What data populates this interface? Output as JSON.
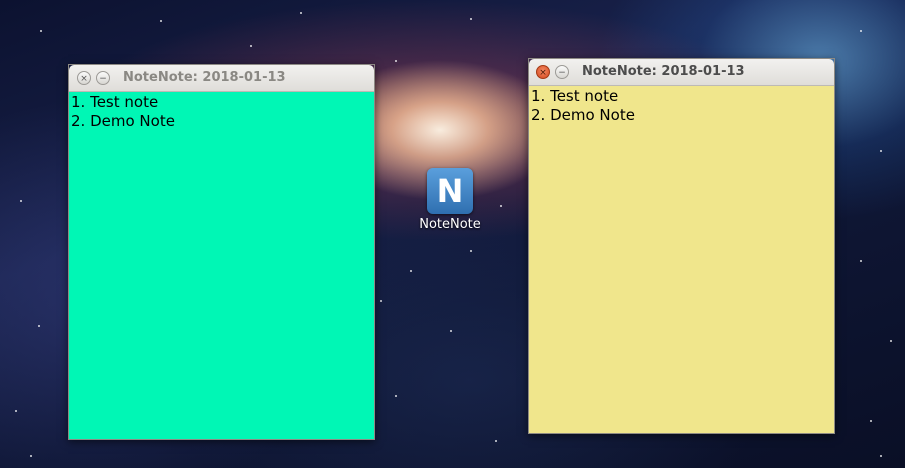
{
  "desktop": {
    "icon": {
      "label": "NoteNote",
      "glyph": "N",
      "icon_name": "notenote-app-icon",
      "tile_color": "#3b82c4"
    }
  },
  "windows": [
    {
      "title": "NoteNote:  2018-01-13",
      "focused": false,
      "bg_color": "#00f7b5",
      "buttons": {
        "close": "×",
        "minimize": "−"
      },
      "lines": [
        "1. Test note",
        "2. Demo Note"
      ]
    },
    {
      "title": "NoteNote:  2018-01-13",
      "focused": true,
      "bg_color": "#f0e68c",
      "buttons": {
        "close": "×",
        "minimize": "−"
      },
      "lines": [
        "1. Test note",
        "2. Demo Note"
      ]
    }
  ]
}
